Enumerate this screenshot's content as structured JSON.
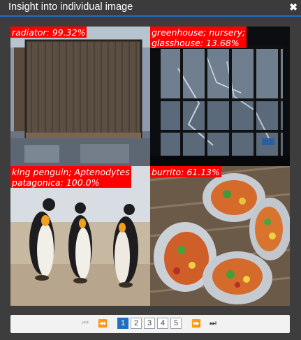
{
  "window": {
    "title": "Insight into individual image",
    "close_symbol": "✖"
  },
  "tiles": [
    {
      "label": "radiator: 99.32%"
    },
    {
      "label": "greenhouse; nursery;\nglasshouse: 13.68%"
    },
    {
      "label": "king penguin; Aptenodytes\npatagonica: 100.0%"
    },
    {
      "label": "burrito: 61.13%"
    }
  ],
  "pagination": {
    "first": "⏮",
    "prev": "⏪",
    "pages": [
      "1",
      "2",
      "3",
      "4",
      "5"
    ],
    "current": "1",
    "next": "⏩",
    "last": "⏭"
  },
  "colors": {
    "accent": "#1f6fbf",
    "label_bg": "#ff0000"
  }
}
